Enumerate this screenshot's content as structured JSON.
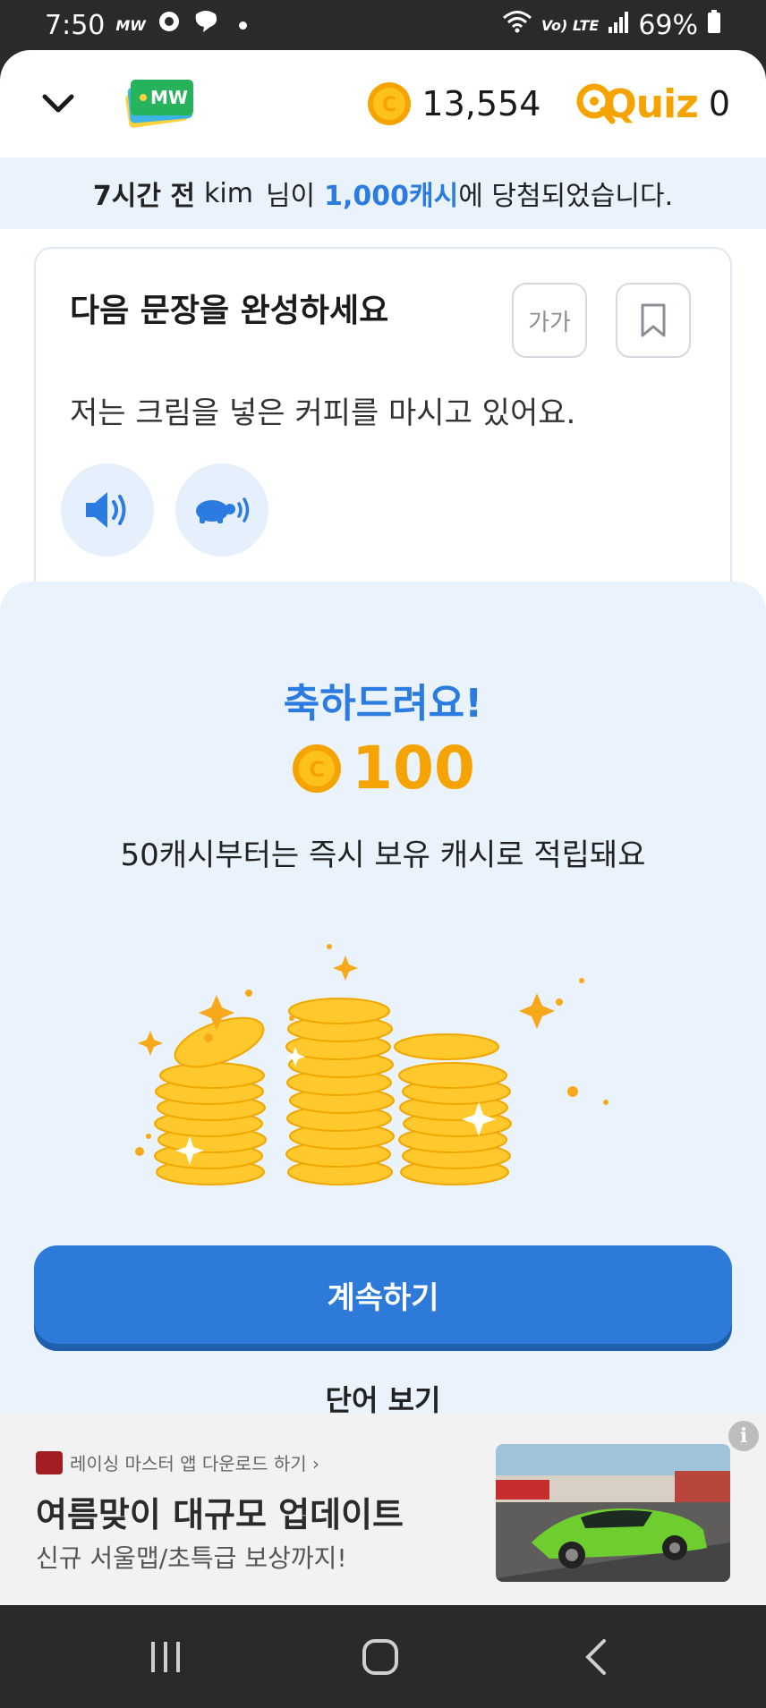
{
  "status_bar": {
    "time": "7:50",
    "app_label": "MW",
    "network": "Vo) LTE",
    "battery": "69%"
  },
  "header": {
    "logo_text": "MW",
    "coin_count": "13,554",
    "quiz_label": "Quiz",
    "quiz_count": "0"
  },
  "notice": {
    "time_ago": "7시간 전",
    "user": "kim",
    "mid": "님이",
    "prize": "1,000캐시",
    "tail": "에 당첨되었습니다."
  },
  "quiz": {
    "title": "다음 문장을 완성하세요",
    "font_size_label": "가가",
    "sentence": "저는 크림을 넣은 커피를 마시고 있어요."
  },
  "sheet": {
    "congrats": "축하드려요!",
    "reward_amount": "100",
    "reward_desc": "50캐시부터는 즉시 보유 캐시로 적립돼요",
    "continue_label": "계속하기",
    "view_words_label": "단어 보기"
  },
  "ad": {
    "source": "레이싱 마스터 앱 다운로드 하기 ›",
    "headline": "여름맞이 대규모 업데이트",
    "subtext": "신규 서울맵/초특급 보상까지!",
    "info_label": "i"
  },
  "colors": {
    "accent": "#2b7be0",
    "button": "#2d7ad9",
    "coin": "#f5a300",
    "sheet_bg": "#eaf2fc"
  }
}
